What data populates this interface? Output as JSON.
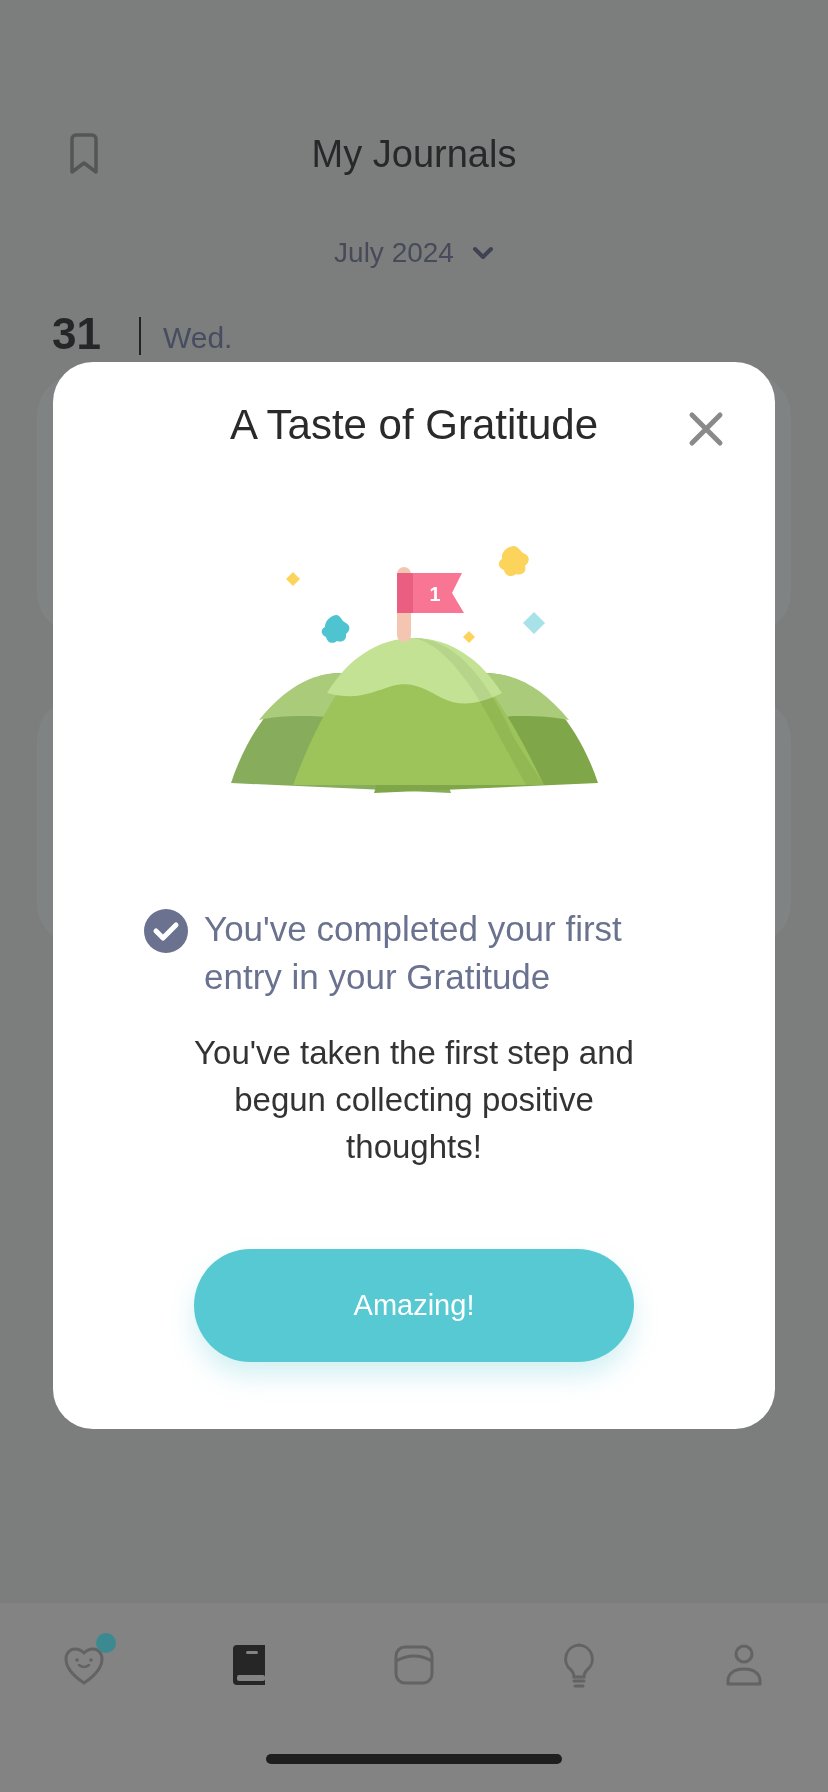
{
  "header": {
    "title": "My Journals"
  },
  "month_picker": {
    "label": "July 2024"
  },
  "day": {
    "date": "31",
    "weekday": "Wed."
  },
  "modal": {
    "title": "A Taste of Gratitude",
    "illustration": {
      "flag_number": "1"
    },
    "achievement": {
      "text": "You've completed your first entry in your Gratitude",
      "checked": true
    },
    "message": "You've taken the first step and begun collecting positive thoughts!",
    "button": "Amazing!"
  },
  "tab_bar": {
    "tabs": [
      {
        "kind": "heart",
        "selected": false,
        "badge": true
      },
      {
        "kind": "journal",
        "selected": true,
        "badge": false
      },
      {
        "kind": "card",
        "selected": false,
        "badge": false
      },
      {
        "kind": "bulb",
        "selected": false,
        "badge": false
      },
      {
        "kind": "profile",
        "selected": false,
        "badge": false
      }
    ]
  }
}
